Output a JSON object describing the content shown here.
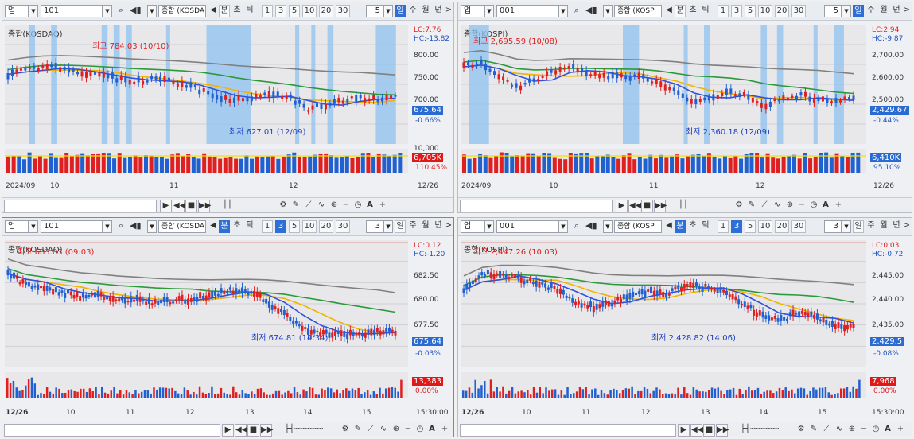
{
  "toolbar": {
    "market_code": "업",
    "ranges": {
      "minute": "분",
      "second": "초",
      "tick": "틱"
    },
    "periods": [
      "1",
      "3",
      "5",
      "10",
      "20",
      "30"
    ],
    "types": {
      "day": "일",
      "week": "주",
      "month": "월",
      "year": "년"
    },
    "next": ">",
    "prev": "◀"
  },
  "panels": [
    {
      "code": "101",
      "name_field": "종합 (KOSDA",
      "title": "종합(KOSDAQ)",
      "interval_value": "5",
      "active_period": "일",
      "lc": "LC:7.76",
      "hc": "HC:-13.82",
      "y_ticks": [
        "800.00",
        "750.00",
        "700.00"
      ],
      "current": "675.64",
      "change": "-0.66%",
      "vol_tick": "10,000",
      "vol_current": "6,705K",
      "vol_pct": "110.45%",
      "x_labels": [
        "2024/09",
        "10",
        "11",
        "12",
        "12/26"
      ],
      "high_label": "최고 784.03 (10/10)",
      "low_label": "최저 627.01 (12/09)",
      "chart_data": {
        "type": "candlestick",
        "high": 784.03,
        "high_date": "10/10",
        "low": 627.01,
        "low_date": "12/09",
        "last": 675.64
      }
    },
    {
      "code": "001",
      "name_field": "종합 (KOSP",
      "title": "종합(KOSPI)",
      "interval_value": "5",
      "active_period": "일",
      "lc": "LC:2.94",
      "hc": "HC:-9.87",
      "y_ticks": [
        "2,700.00",
        "2,600.00",
        "2,500.00"
      ],
      "current": "2,429.67",
      "change": "-0.44%",
      "vol_tick": "",
      "vol_current": "6,410K",
      "vol_pct": "95.10%",
      "x_labels": [
        "2024/09",
        "10",
        "11",
        "12",
        "12/26"
      ],
      "high_label": "최고 2,695.59 (10/08)",
      "low_label": "최저 2,360.18 (12/09)",
      "chart_data": {
        "type": "candlestick",
        "high": 2695.59,
        "high_date": "10/08",
        "low": 2360.18,
        "low_date": "12/09",
        "last": 2429.67
      }
    },
    {
      "code": "101",
      "name_field": "종합 (KOSDA",
      "title": "종합(KOSDAQ)",
      "interval_value": "3",
      "active_period": "3",
      "lc": "LC:0.12",
      "hc": "HC:-1.20",
      "y_ticks": [
        "682.50",
        "680.00",
        "677.50"
      ],
      "current": "675.64",
      "change": "-0.03%",
      "vol_tick": "",
      "vol_current": "13,383",
      "vol_pct": "0.00%",
      "x_labels": [
        "12/26",
        "10",
        "11",
        "12",
        "13",
        "14",
        "15",
        "15:30:00"
      ],
      "high_label": "최고 683.83 (09:03)",
      "low_label": "최저 674.81 (14:34)",
      "chart_data": {
        "type": "candlestick",
        "high": 683.83,
        "high_time": "09:03",
        "low": 674.81,
        "low_time": "14:34",
        "last": 675.64
      }
    },
    {
      "code": "001",
      "name_field": "종합 (KOSP",
      "title": "종합(KOSPI)",
      "interval_value": "3",
      "active_period": "3",
      "lc": "LC:0.03",
      "hc": "HC:-0.72",
      "y_ticks": [
        "2,445.00",
        "2,440.00",
        "2,435.00"
      ],
      "current": "2,429.5",
      "change": "-0.08%",
      "vol_tick": "",
      "vol_current": "7,968",
      "vol_pct": "0.00%",
      "x_labels": [
        "12/26",
        "10",
        "11",
        "12",
        "13",
        "14",
        "15",
        "15:30:00"
      ],
      "high_label": "최고 2,447.26 (10:03)",
      "low_label": "최저 2,428.82 (14:06)",
      "chart_data": {
        "type": "candlestick",
        "high": 2447.26,
        "high_time": "10:03",
        "low": 2428.82,
        "low_time": "14:06",
        "last": 2429.5
      }
    }
  ],
  "bottom": {
    "minus": "−",
    "plus": "+",
    "auto": "A"
  }
}
